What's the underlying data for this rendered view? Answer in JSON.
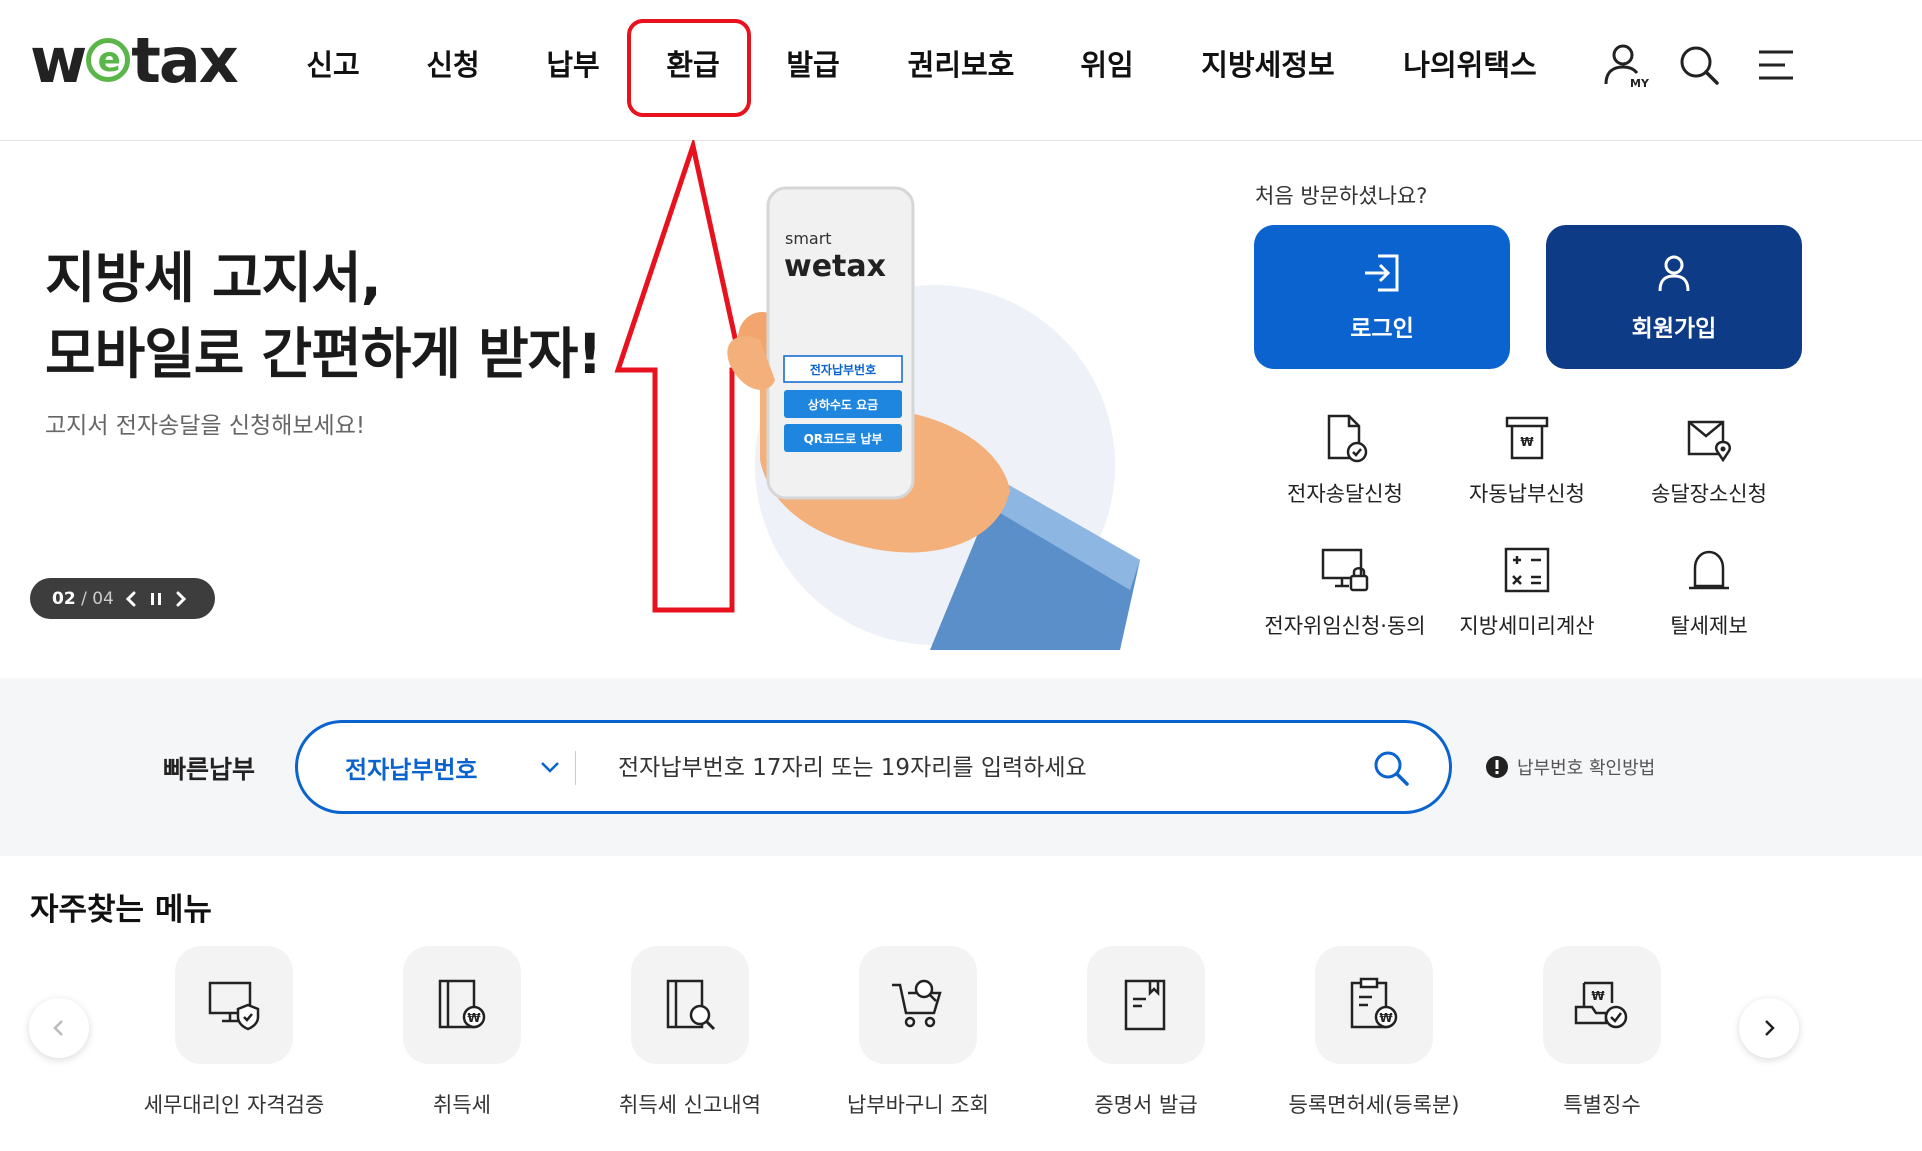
{
  "logo": {
    "text": "wetax",
    "before": "w",
    "e": "e",
    "after": "tax"
  },
  "nav": {
    "items": [
      "신고",
      "신청",
      "납부",
      "환급",
      "발급",
      "권리보호",
      "위임",
      "지방세정보",
      "나의위택스"
    ],
    "highlighted": "환급",
    "my_label": "MY"
  },
  "hero": {
    "title_line1": "지방세 고지서,",
    "title_line2": "모바일로 간편하게 받자!",
    "subtitle": "고지서 전자송달을 신청해보세요!",
    "pager_current": "02",
    "pager_sep": "/",
    "pager_total": "04",
    "phone": {
      "smart": "smart",
      "logo": "wetax",
      "btn1": "전자납부번호",
      "btn2": "상하수도 요금",
      "btn3": "QR코드로 납부"
    }
  },
  "panel": {
    "first_visit": "처음 방문하셨나요?",
    "login": "로그인",
    "join": "회원가입",
    "services": [
      {
        "label": "전자송달신청",
        "icon": "e-delivery-document-icon"
      },
      {
        "label": "자동납부신청",
        "icon": "auto-payment-icon"
      },
      {
        "label": "송달장소신청",
        "icon": "delivery-location-icon"
      },
      {
        "label": "전자위임신청·동의",
        "icon": "e-delegation-monitor-icon"
      },
      {
        "label": "지방세미리계산",
        "icon": "calculator-icon"
      },
      {
        "label": "탈세제보",
        "icon": "siren-icon"
      }
    ]
  },
  "quick_pay": {
    "label": "빠른납부",
    "select_value": "전자납부번호",
    "placeholder": "전자납부번호 17자리 또는 19자리를 입력하세요",
    "help": "납부번호 확인방법"
  },
  "frequent": {
    "title": "자주찾는 메뉴",
    "items": [
      {
        "label": "세무대리인 자격검증",
        "icon": "agent-verification-icon"
      },
      {
        "label": "취득세",
        "icon": "acquisition-tax-icon"
      },
      {
        "label": "취득세 신고내역",
        "icon": "report-history-icon"
      },
      {
        "label": "납부바구니 조회",
        "icon": "payment-cart-icon"
      },
      {
        "label": "증명서 발급",
        "icon": "certificate-icon"
      },
      {
        "label": "등록면허세(등록분)",
        "icon": "registration-tax-icon"
      },
      {
        "label": "특별징수",
        "icon": "special-collection-icon"
      }
    ]
  },
  "colors": {
    "primary": "#0a63cf",
    "navy": "#0e3b85",
    "highlight": "#e8121f",
    "logo_green": "#5bb64a"
  }
}
